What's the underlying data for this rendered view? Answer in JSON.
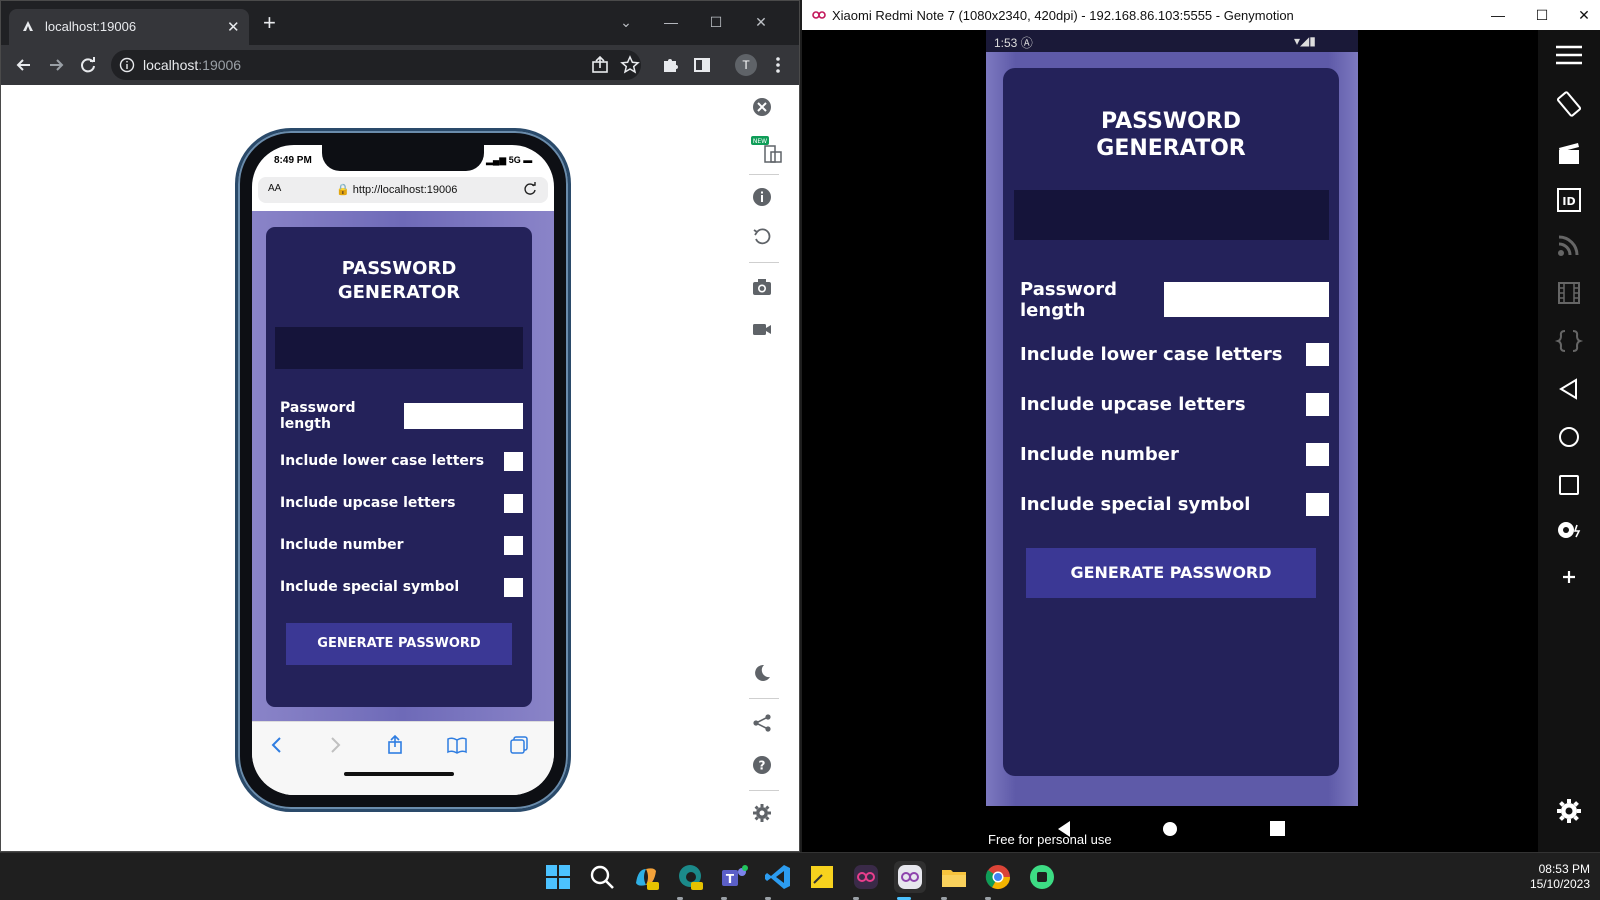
{
  "chrome": {
    "tab_title": "localhost:19006",
    "url_host": "localhost",
    "url_port": ":19006",
    "profile_initial": "T",
    "new_badge": "NEW"
  },
  "iphone": {
    "time": "8:49 PM",
    "network": "5G",
    "aa_label": "AA",
    "url": "http://localhost:19006"
  },
  "app": {
    "title_line1": "PASSWORD",
    "title_line2": "GENERATOR",
    "password_output": "",
    "length_label": "Password length",
    "length_value": "",
    "options": [
      {
        "label": "Include lower case letters"
      },
      {
        "label": "Include upcase letters"
      },
      {
        "label": "Include number"
      },
      {
        "label": "Include special symbol"
      }
    ],
    "generate_label": "GENERATE PASSWORD"
  },
  "genymotion": {
    "window_title": "Xiaomi Redmi Note 7 (1080x2340, 420dpi) - 192.168.86.103:5555 - Genymotion",
    "android_time": "1:53",
    "watermark": "Free for personal use"
  },
  "taskbar": {
    "time": "08:53 PM",
    "date": "15/10/2023"
  },
  "colors": {
    "card": "#24225a",
    "output": "#15143a",
    "button": "#3b3895",
    "background_glow": "#7d79c0"
  }
}
